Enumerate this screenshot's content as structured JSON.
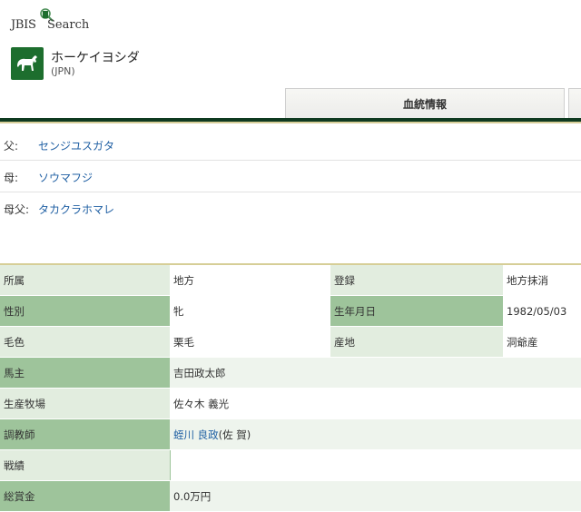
{
  "logo": {
    "line1": "JBIS",
    "line2": "Search"
  },
  "horse": {
    "name": "ホーケイヨシダ",
    "origin": "(JPN)"
  },
  "tabs": {
    "active": "血統情報"
  },
  "pedigree": [
    {
      "key": "父:",
      "value": "センジユスガタ"
    },
    {
      "key": "母:",
      "value": "ソウマフジ"
    },
    {
      "key": "母父:",
      "value": "タカクラホマレ"
    }
  ],
  "info": {
    "affiliation": {
      "label": "所属",
      "value": "地方"
    },
    "registration": {
      "label": "登録",
      "value": "地方抹消"
    },
    "sex": {
      "label": "性別",
      "value": "牝"
    },
    "birthdate": {
      "label": "生年月日",
      "value": "1982/05/03"
    },
    "coat": {
      "label": "毛色",
      "value": "栗毛"
    },
    "birthplace": {
      "label": "産地",
      "value": "洞爺産"
    },
    "owner": {
      "label": "馬主",
      "value": "吉田政太郎"
    },
    "breeder": {
      "label": "生産牧場",
      "value": "佐々木 義光"
    },
    "trainer": {
      "label": "調教師",
      "value": "蛭川 良政",
      "note": "(佐 賀)"
    },
    "record": {
      "label": "戦績",
      "value": ""
    },
    "earnings": {
      "label": "総賞金",
      "value": "0.0万円"
    }
  },
  "colors": {
    "brand_green": "#1d6e2e",
    "key_green": "#9ec49b",
    "link_blue": "#1f5fa3",
    "band": "#0f3a20"
  }
}
